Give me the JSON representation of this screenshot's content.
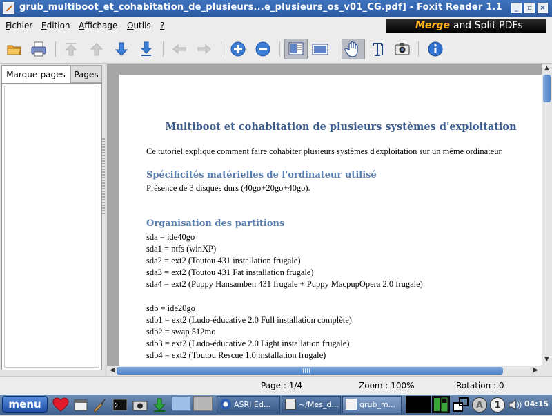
{
  "window": {
    "title": "grub_multiboot_et_cohabitation_de_plusieurs...e_plusieurs_os_v01_CG.pdf] - Foxit Reader 1.1",
    "minimize_label": "_",
    "maximize_label": "▫",
    "close_label": "×"
  },
  "menu": {
    "fichier": {
      "first": "F",
      "rest": "ichier"
    },
    "edition": {
      "first": "E",
      "rest": "dition"
    },
    "affichage": {
      "first": "A",
      "rest": "ffichage"
    },
    "outils": {
      "first": "O",
      "rest": "utils"
    },
    "help": {
      "first": "?",
      "rest": ""
    }
  },
  "banner": {
    "merge": "Merge",
    "rest": "and Split PDFs"
  },
  "sidebar": {
    "tabs": [
      {
        "label": "Marque-pages"
      },
      {
        "label": "Pages"
      }
    ]
  },
  "document": {
    "title": "Multiboot et cohabitation de plusieurs systèmes d'exploitation",
    "intro": "Ce tutoriel explique comment faire cohabiter plusieurs systèmes d'exploitation sur un même ordinateur.",
    "section1": {
      "heading": "Spécificités matérielles de l'ordinateur utilisé",
      "text": "Présence de 3 disques durs (40go+20go+40go)."
    },
    "section2": {
      "heading": "Organisation des partitions",
      "lines": [
        "sda = ide40go",
        "sda1 = ntfs (winXP)",
        "sda2 = ext2 (Toutou 431 installation frugale)",
        "sda3 = ext2 (Toutou 431 Fat installation frugale)",
        "sda4 = ext2 (Puppy Hansamben 431 frugale + Puppy MacpupOpera 2.0 frugale)",
        "sdb = ide20go",
        "sdb1 = ext2 (Ludo-éducative 2.0 Full installation complète)",
        "sdb2 = swap 512mo",
        "sdb3 = ext2 (Ludo-éducative 2.0 Light installation frugale)",
        "sdb4 = ext2 (Toutou Rescue 1.0 installation frugale)"
      ]
    }
  },
  "status": {
    "page": "Page : 1/4",
    "zoom": "Zoom : 100%",
    "rotation": "Rotation : 0"
  },
  "taskbar": {
    "menu_label": "menu",
    "tasks": [
      {
        "label": "ASRI Ed..."
      },
      {
        "label": "~/Mes_d..."
      },
      {
        "label": "grub_m..."
      }
    ],
    "clock": "04:15"
  }
}
